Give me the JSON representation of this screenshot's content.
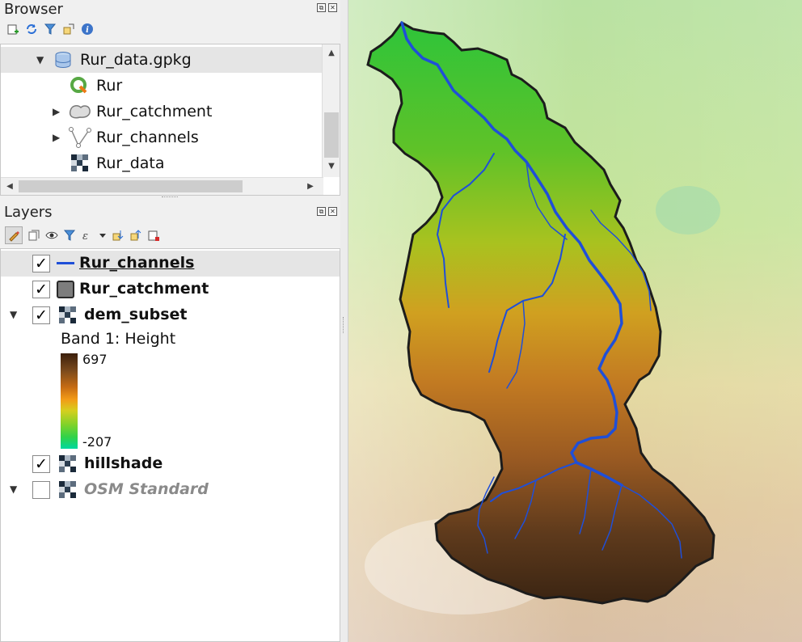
{
  "browser": {
    "title": "Browser",
    "items": [
      {
        "label": "Rur_data.gpkg",
        "icon": "geopackage-icon"
      },
      {
        "label": "Rur",
        "icon": "qgis-project-icon"
      },
      {
        "label": "Rur_catchment",
        "icon": "polygon-layer-icon"
      },
      {
        "label": "Rur_channels",
        "icon": "line-layer-icon"
      },
      {
        "label": "Rur_data",
        "icon": "raster-layer-icon"
      }
    ]
  },
  "layers": {
    "title": "Layers",
    "items": [
      {
        "label": "Rur_channels",
        "checked": true,
        "icon": "line-symbol-icon"
      },
      {
        "label": "Rur_catchment",
        "checked": true,
        "icon": "fill-symbol-icon"
      },
      {
        "label": "dem_subset",
        "checked": true,
        "icon": "raster-layer-icon"
      },
      {
        "label": "hillshade",
        "checked": true,
        "icon": "raster-layer-icon"
      },
      {
        "label": "OSM Standard",
        "checked": false,
        "icon": "raster-layer-icon"
      }
    ],
    "legend": {
      "band_label": "Band 1: Height",
      "max": "697",
      "min": "-207"
    }
  },
  "colors": {
    "accent": "#1f56d6",
    "selected_row": "#e5e5e5",
    "channel_blue": "#1f4fd8",
    "catchment_outline": "#1c1c1c"
  }
}
